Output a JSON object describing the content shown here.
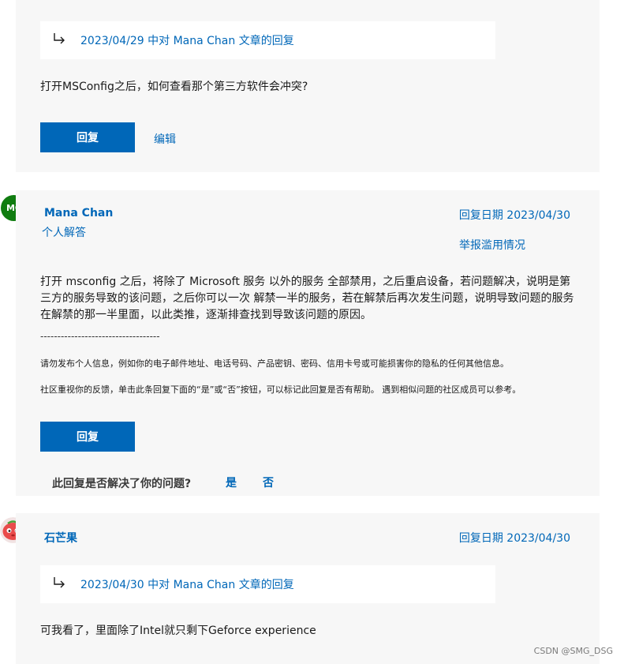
{
  "reply1": {
    "quote_link": "2023/04/29 中对 Mana Chan 文章的回复",
    "body": "打开MSConfig之后，如何查看那个第三方软件会冲突?",
    "reply_button": "回复",
    "edit_link": "编辑"
  },
  "reply2": {
    "avatar_initials": "MC",
    "author": "Mana Chan",
    "role": "个人解答",
    "date": "回复日期 2023/04/30",
    "report_link": "举报滥用情况",
    "body": "打开 msconfig 之后，将除了 Microsoft 服务 以外的服务 全部禁用，之后重启设备，若问题解决，说明是第三方的服务导致的该问题，之后你可以一次 解禁一半的服务，若在解禁后再次发生问题，说明导致问题的服务在解禁的那一半里面，以此类推，逐渐排查找到导致该问题的原因。",
    "divider": "-----------------------------------",
    "notice1": "请勿发布个人信息，例如你的电子邮件地址、电话号码、产品密钥、密码、信用卡号或可能损害你的隐私的任何其他信息。",
    "notice2": "社区重视你的反馈，单击此条回复下面的“是”或“否”按钮，可以标记此回复是否有帮助。 遇到相似问题的社区成员可以参考。",
    "reply_button": "回复",
    "helpful_question": "此回复是否解决了你的问题?",
    "yes": "是",
    "no": "否"
  },
  "reply3": {
    "author": "石芒果",
    "date": "回复日期 2023/04/30",
    "quote_link": "2023/04/30 中对 Mana Chan 文章的回复",
    "body": "可我看了，里面除了Intel就只剩下Geforce experience"
  },
  "watermark": "CSDN @SMG_DSG",
  "colors": {
    "accent": "#0067b8",
    "card_bg": "#f7f7f7",
    "avatar_green": "#107c10"
  }
}
